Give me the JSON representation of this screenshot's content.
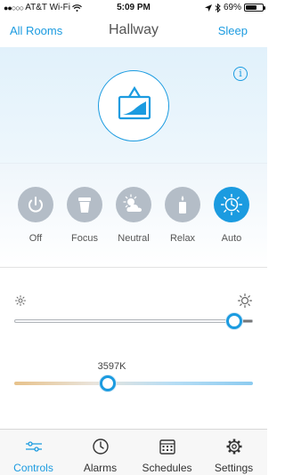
{
  "status_bar": {
    "carrier": "AT&T Wi-Fi",
    "time": "5:09 PM",
    "battery": "69%",
    "battery_level": 0.69,
    "icons": [
      "signal-dots-icon",
      "wifi-icon",
      "location-arrow-icon",
      "bluetooth-icon",
      "battery-icon"
    ]
  },
  "nav": {
    "left": "All Rooms",
    "title": "Hallway",
    "right": "Sleep"
  },
  "hero": {
    "icon": "scene-picture-icon",
    "info_icon": "info-icon",
    "info_glyph": "i"
  },
  "modes": [
    {
      "label": "Off",
      "icon": "power-icon",
      "active": false
    },
    {
      "label": "Focus",
      "icon": "cup-icon",
      "active": false
    },
    {
      "label": "Neutral",
      "icon": "cloud-sun-icon",
      "active": false
    },
    {
      "label": "Relax",
      "icon": "candle-icon",
      "active": false
    },
    {
      "label": "Auto",
      "icon": "sun-clock-icon",
      "active": true
    }
  ],
  "brightness": {
    "min_icon": "sun-small-icon",
    "max_icon": "sun-large-icon",
    "level": 0.92
  },
  "color_temperature": {
    "value_label": "3597K",
    "position": 0.39
  },
  "tabs": [
    {
      "label": "Controls",
      "icon": "sliders-icon",
      "active": true
    },
    {
      "label": "Alarms",
      "icon": "clock-icon",
      "active": false
    },
    {
      "label": "Schedules",
      "icon": "calendar-icon",
      "active": false
    },
    {
      "label": "Settings",
      "icon": "gear-icon",
      "active": false
    }
  ],
  "colors": {
    "accent": "#1b9be0",
    "mode_inactive": "#b4bdc7",
    "hero_bg": "#e1f1fb"
  }
}
